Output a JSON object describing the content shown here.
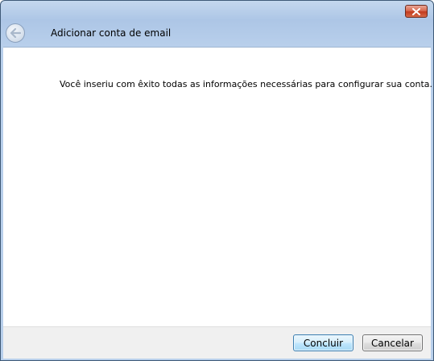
{
  "window": {
    "title": "Adicionar conta de email"
  },
  "content": {
    "message": "Você inseriu com êxito todas as informações necessárias para configurar sua conta."
  },
  "footer": {
    "finish_label": "Concluir",
    "cancel_label": "Cancelar"
  },
  "icons": {
    "close": "close-icon",
    "back": "back-arrow-icon"
  },
  "colors": {
    "close_button": "#c23a1e",
    "title_bar": "#adc6e6",
    "primary_button": "#bee6fd"
  }
}
